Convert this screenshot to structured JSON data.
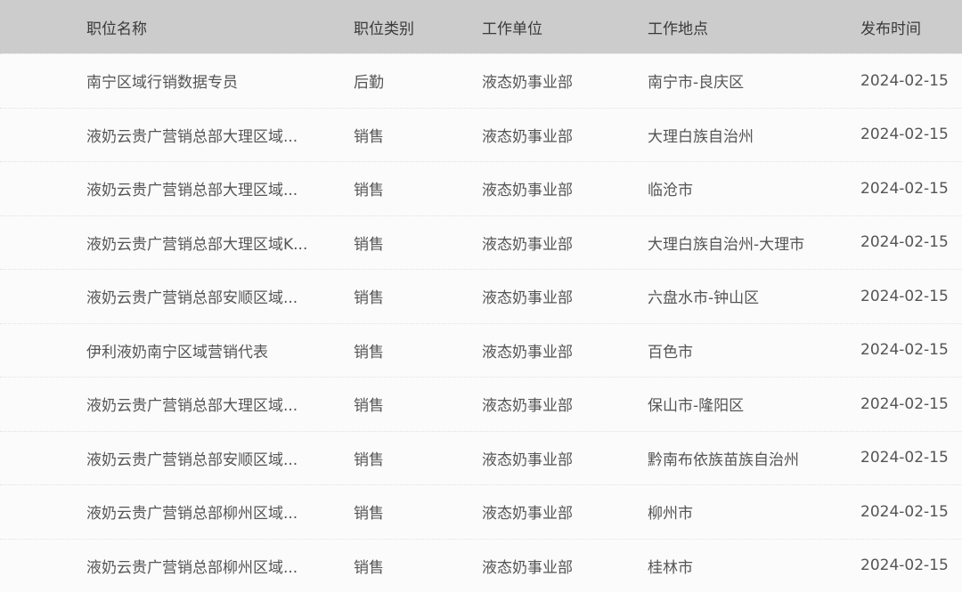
{
  "table": {
    "headers": [
      "职位名称",
      "职位类别",
      "工作单位",
      "工作地点",
      "发布时间"
    ],
    "rows": [
      {
        "title": "南宁区域行销数据专员",
        "category": "后勤",
        "unit": "液态奶事业部",
        "location": "南宁市-良庆区",
        "date": "2024-02-15"
      },
      {
        "title": "液奶云贵广营销总部大理区域...",
        "category": "销售",
        "unit": "液态奶事业部",
        "location": "大理白族自治州",
        "date": "2024-02-15"
      },
      {
        "title": "液奶云贵广营销总部大理区域...",
        "category": "销售",
        "unit": "液态奶事业部",
        "location": "临沧市",
        "date": "2024-02-15"
      },
      {
        "title": "液奶云贵广营销总部大理区域K...",
        "category": "销售",
        "unit": "液态奶事业部",
        "location": "大理白族自治州-大理市",
        "date": "2024-02-15"
      },
      {
        "title": "液奶云贵广营销总部安顺区域...",
        "category": "销售",
        "unit": "液态奶事业部",
        "location": "六盘水市-钟山区",
        "date": "2024-02-15"
      },
      {
        "title": "伊利液奶南宁区域营销代表",
        "category": "销售",
        "unit": "液态奶事业部",
        "location": "百色市",
        "date": "2024-02-15"
      },
      {
        "title": "液奶云贵广营销总部大理区域...",
        "category": "销售",
        "unit": "液态奶事业部",
        "location": "保山市-隆阳区",
        "date": "2024-02-15"
      },
      {
        "title": "液奶云贵广营销总部安顺区域...",
        "category": "销售",
        "unit": "液态奶事业部",
        "location": "黔南布依族苗族自治州",
        "date": "2024-02-15"
      },
      {
        "title": "液奶云贵广营销总部柳州区域...",
        "category": "销售",
        "unit": "液态奶事业部",
        "location": "柳州市",
        "date": "2024-02-15"
      },
      {
        "title": "液奶云贵广营销总部柳州区域...",
        "category": "销售",
        "unit": "液态奶事业部",
        "location": "桂林市",
        "date": "2024-02-15"
      }
    ]
  }
}
